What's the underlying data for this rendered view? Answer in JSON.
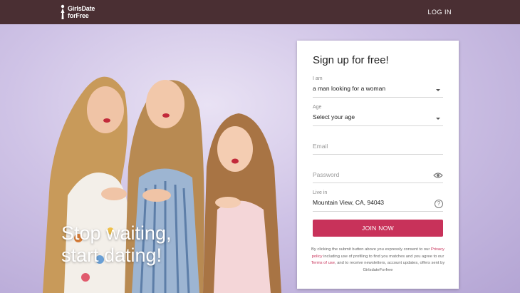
{
  "header": {
    "logo_line1": "GirlsDate",
    "logo_line2": "forFree",
    "login_label": "LOG IN"
  },
  "hero": {
    "headline_line1": "Stop waiting,",
    "headline_line2": "start dating!"
  },
  "signup": {
    "title": "Sign up for free!",
    "iam_label": "I am",
    "iam_value": "a man looking for a woman",
    "age_label": "Age",
    "age_value": "Select your age",
    "email_placeholder": "Email",
    "password_placeholder": "Password",
    "live_label": "Live in",
    "live_value": "Mountain View, CA, 94043",
    "join_label": "JOIN NOW",
    "legal": {
      "part1": "By clicking the submit button above you expressly consent to our ",
      "privacy_link": "Privacy policy",
      "part2": " including use of profiling to find you matches and you agree to our ",
      "terms_link": "Terms of use",
      "part3": ", and to receive newsletters, account updates, offers sent by GirlsdateForfree"
    }
  },
  "colors": {
    "header_bg": "#4a2f33",
    "accent": "#c8325a",
    "hero_bg": "#cfc3e6"
  },
  "icons": [
    "woman-silhouette-icon",
    "chevron-down-icon",
    "eye-icon",
    "help-icon"
  ]
}
